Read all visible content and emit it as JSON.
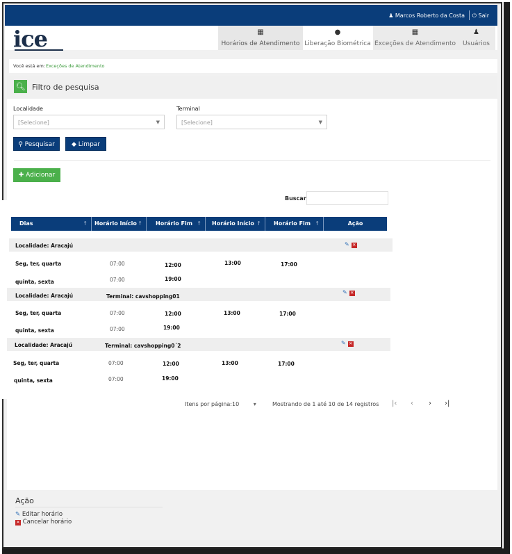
{
  "topbar": {
    "user_name": "Marcos Roberto da Costa",
    "logout_label": "Sair"
  },
  "logo_text": "ice",
  "nav": [
    {
      "label": "Horários de Atendimento",
      "icon": "calendar-icon",
      "glyph": "▦",
      "active": true
    },
    {
      "label": "Liberação Biométrica",
      "icon": "check-circle-icon",
      "glyph": "●",
      "active": false
    },
    {
      "label": "Exceções de Atendimento",
      "icon": "calendar-icon",
      "glyph": "▦",
      "active": false
    },
    {
      "label": "Usuários",
      "icon": "user-icon",
      "glyph": "♟",
      "active": false
    }
  ],
  "breadcrumb": {
    "prefix": "Você está em:",
    "current": "Exceções de Atendimento"
  },
  "filter": {
    "title": "Filtro de pesquisa",
    "localidade_label": "Localidade",
    "localidade_value": "[Selecione]",
    "terminal_label": "Terminal",
    "terminal_value": "[Selecione]",
    "search_button": "Pesquisar",
    "clear_button": "Limpar"
  },
  "add_button": "Adicionar",
  "buscar_label": "Buscar",
  "table": {
    "headers": [
      "Dias",
      "Horário Início",
      "Horário Fim",
      "Horário Início",
      "Horário Fim",
      "Ação"
    ],
    "groups": [
      {
        "localidade": "Localidade: Aracajú",
        "terminal": "",
        "rows": [
          {
            "dias": "Seg, ter, quarta",
            "inicio1": "07:00",
            "fim1": "12:00",
            "inicio2": "13:00",
            "fim2": "17:00"
          },
          {
            "dias": "quinta, sexta",
            "inicio1": "07:00",
            "fim1": "19:00",
            "inicio2": "",
            "fim2": ""
          }
        ]
      },
      {
        "localidade": "Localidade: Aracajú",
        "terminal": "Terminal: cavshopping01",
        "rows": [
          {
            "dias": "Seg, ter, quarta",
            "inicio1": "07:00",
            "fim1": "12:00",
            "inicio2": "13:00",
            "fim2": "17:00"
          },
          {
            "dias": "quinta, sexta",
            "inicio1": "07:00",
            "fim1": "19:00",
            "inicio2": "",
            "fim2": ""
          }
        ]
      },
      {
        "localidade": "Localidade: Aracajú",
        "terminal": "Terminal: cavshopping0´2",
        "rows": [
          {
            "dias": "Seg, ter, quarta",
            "inicio1": "07:00",
            "fim1": "12:00",
            "inicio2": "13:00",
            "fim2": "17:00"
          },
          {
            "dias": "quinta, sexta",
            "inicio1": "07:00",
            "fim1": "19:00",
            "inicio2": "",
            "fim2": ""
          }
        ]
      }
    ]
  },
  "pagination": {
    "items_per_page_label": "Itens por página:",
    "items_per_page_value": "10",
    "range_text": "Mostrando de 1 até 10 de 14 registros"
  },
  "legend": {
    "title": "Ação",
    "edit_label": "Editar horário",
    "cancel_label": "Cancelar horário"
  },
  "colors": {
    "primary": "#0a3d7a",
    "success": "#4bb04b",
    "danger": "#c62828",
    "link": "#3a9a3a"
  }
}
